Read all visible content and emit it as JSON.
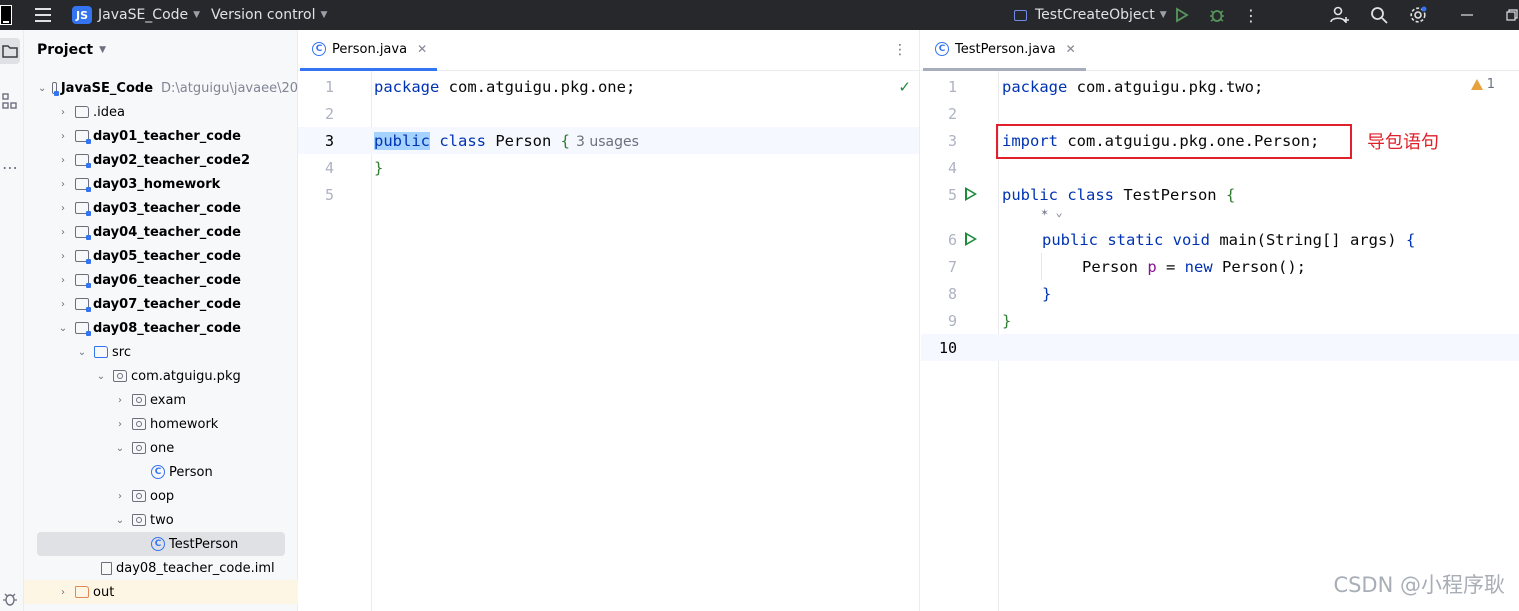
{
  "titlebar": {
    "project_badge": "JS",
    "project_name": "JavaSE_Code",
    "version_control": "Version control",
    "run_config": "TestCreateObject"
  },
  "project_panel": {
    "title": "Project",
    "tree": [
      {
        "label": "JavaSE_Code",
        "path": "D:\\atguigu\\javaee\\20",
        "icon": "module-icon",
        "expanded": true
      },
      {
        "label": ".idea",
        "icon": "folder-icon"
      },
      {
        "label": "day01_teacher_code",
        "icon": "module-icon"
      },
      {
        "label": "day02_teacher_code2",
        "icon": "module-icon"
      },
      {
        "label": "day03_homework",
        "icon": "module-icon"
      },
      {
        "label": "day03_teacher_code",
        "icon": "module-icon"
      },
      {
        "label": "day04_teacher_code",
        "icon": "module-icon"
      },
      {
        "label": "day05_teacher_code",
        "icon": "module-icon"
      },
      {
        "label": "day06_teacher_code",
        "icon": "module-icon"
      },
      {
        "label": "day07_teacher_code",
        "icon": "module-icon"
      },
      {
        "label": "day08_teacher_code",
        "icon": "module-icon",
        "expanded": true
      },
      {
        "label": "src",
        "icon": "source-folder-icon",
        "expanded": true
      },
      {
        "label": "com.atguigu.pkg",
        "icon": "package-icon",
        "expanded": true
      },
      {
        "label": "exam",
        "icon": "package-icon"
      },
      {
        "label": "homework",
        "icon": "package-icon"
      },
      {
        "label": "one",
        "icon": "package-icon",
        "expanded": true
      },
      {
        "label": "Person",
        "icon": "class-icon"
      },
      {
        "label": "oop",
        "icon": "package-icon"
      },
      {
        "label": "two",
        "icon": "package-icon",
        "expanded": true
      },
      {
        "label": "TestPerson",
        "icon": "runnable-class-icon",
        "selected": true
      },
      {
        "label": "day08_teacher_code.iml",
        "icon": "iml-file-icon"
      },
      {
        "label": "out",
        "icon": "excluded-folder-icon"
      }
    ]
  },
  "left_editor": {
    "tab_label": "Person.java",
    "lines": {
      "n1": "1",
      "n2": "2",
      "n3": "3",
      "n4": "4",
      "n5": "5",
      "l1_kw": "package",
      "l1_rest": " com.atguigu.pkg.one;",
      "l3_kw1": "public",
      "l3_kw2": " class",
      "l3_rest": " Person ",
      "l3_brace": "{",
      "l3_hint": "3 usages",
      "l4_brace": "}"
    }
  },
  "right_editor": {
    "tab_label": "TestPerson.java",
    "warning_count": "1",
    "lines": {
      "n1": "1",
      "n2": "2",
      "n3": "3",
      "n4": "4",
      "n5": "5",
      "n6": "6",
      "n7": "7",
      "n8": "8",
      "n9": "9",
      "n10": "10",
      "l1_kw": "package",
      "l1_rest": " com.atguigu.pkg.two;",
      "l3_kw": "import",
      "l3_rest": " com.atguigu.pkg.one.Person;",
      "l5_kw": "public class",
      "l5_rest": " TestPerson ",
      "l5_brace": "{",
      "l6_kw": "public static void",
      "l6_rest": " main(String[] args) ",
      "l6_brace": "{",
      "l7_a": "Person ",
      "l7_var": "p",
      "l7_b": " = ",
      "l7_kw": "new",
      "l7_c": " Person();",
      "l8_brace": "}",
      "l9_brace": "}"
    }
  },
  "annotation": "导包语句",
  "watermark": "CSDN @小程序耿"
}
